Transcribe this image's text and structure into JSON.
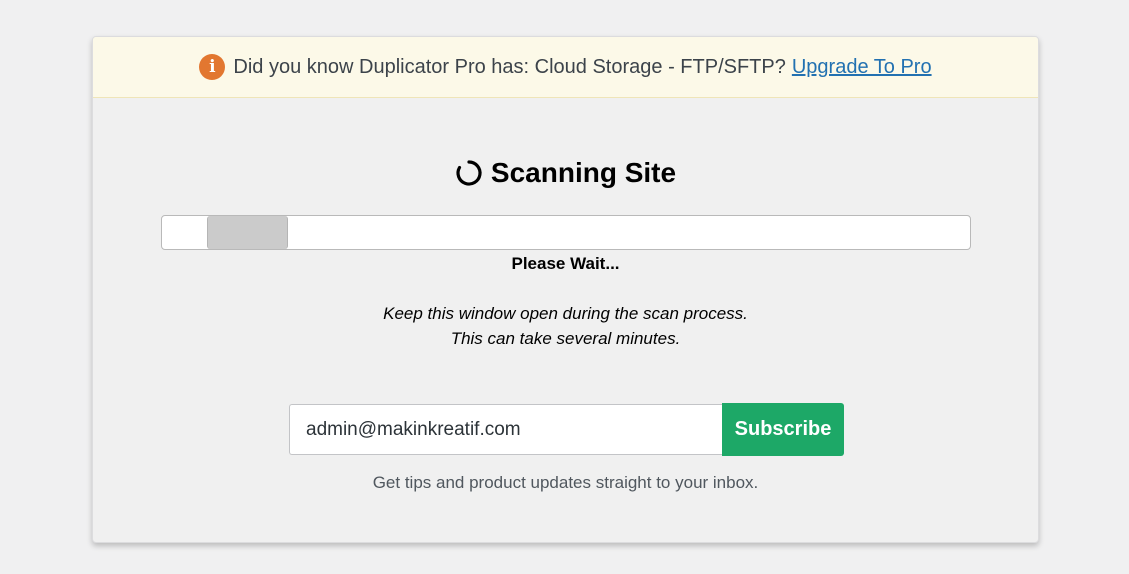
{
  "notice": {
    "icon": "info-icon",
    "icon_glyph": "i",
    "text": "Did you know Duplicator Pro has: Cloud Storage - FTP/SFTP?",
    "link_label": "Upgrade To Pro",
    "colors": {
      "icon_bg": "#e27730",
      "link": "#2271b1",
      "bg": "#fcf9e8"
    }
  },
  "scan": {
    "spinner_icon": "spinner-icon",
    "title": "Scanning Site",
    "wait_text": "Please Wait...",
    "note_line1": "Keep this window open during the scan process.",
    "note_line2": "This can take several minutes."
  },
  "subscribe": {
    "email_value": "admin@makinkreatif.com",
    "button_label": "Subscribe",
    "tips": "Get tips and product updates straight to your inbox.",
    "colors": {
      "button_bg": "#1da867"
    }
  }
}
